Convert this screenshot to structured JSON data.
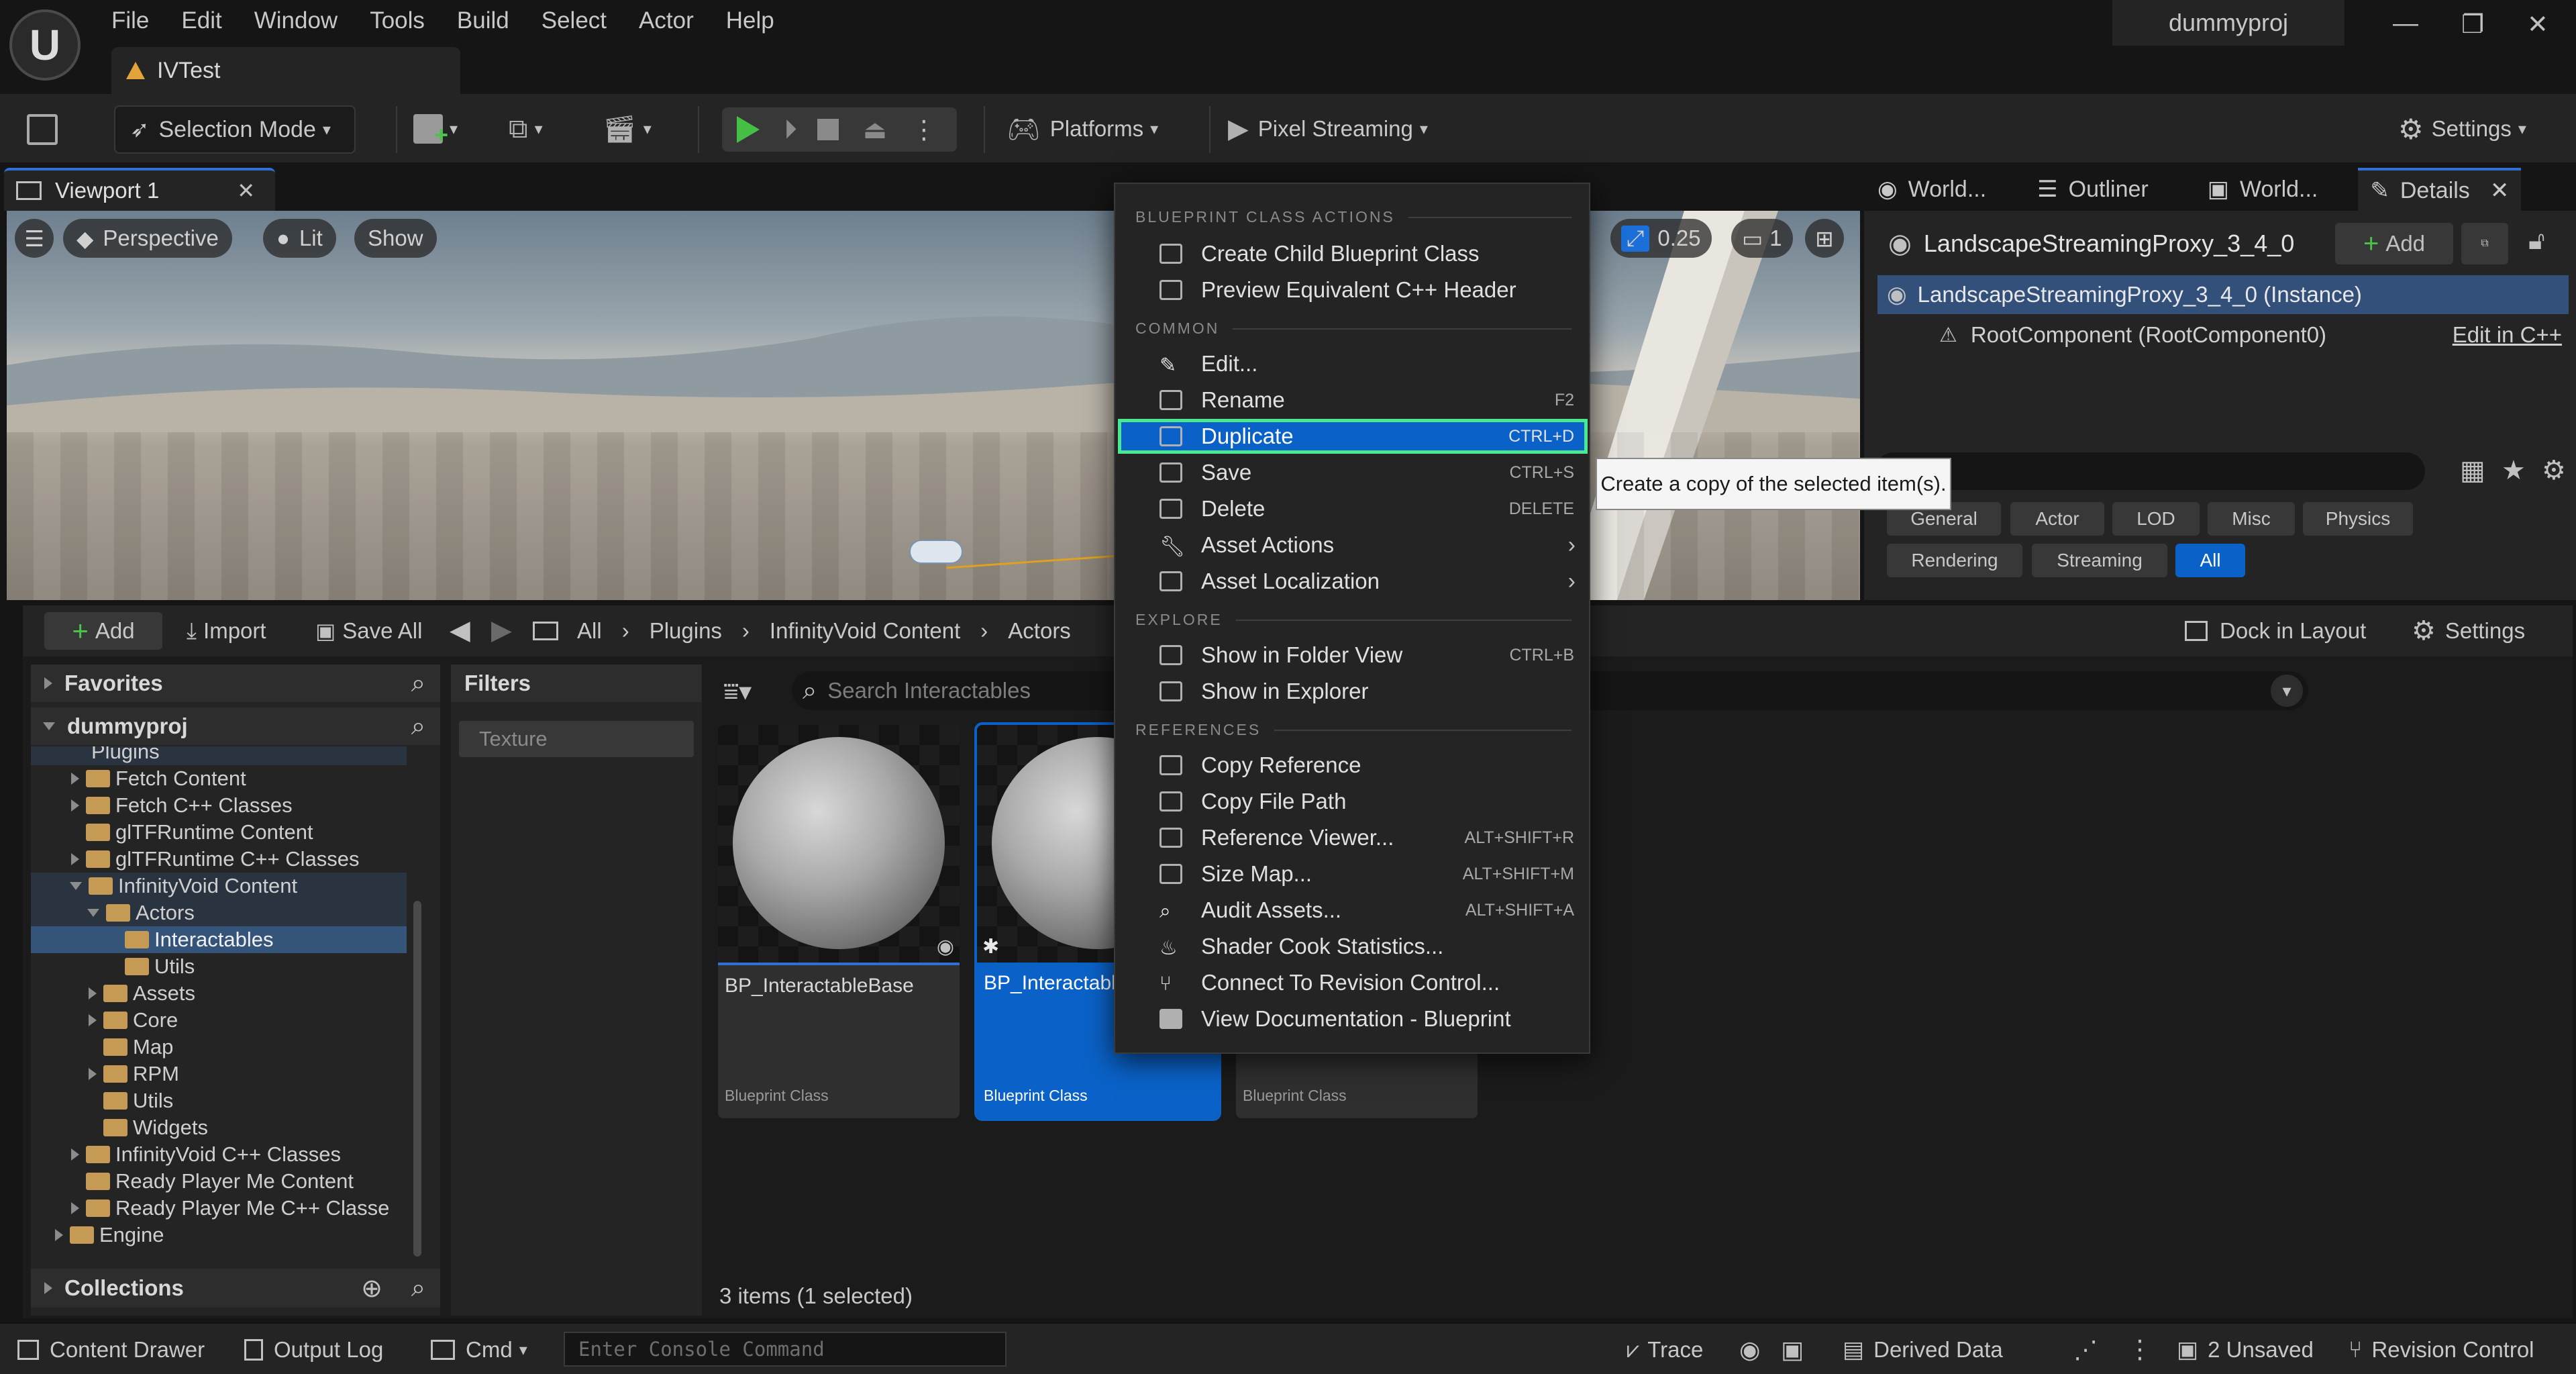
{
  "titlebar": {
    "menu": [
      "File",
      "Edit",
      "Window",
      "Tools",
      "Build",
      "Select",
      "Actor",
      "Help"
    ],
    "project_name": "dummyproj",
    "doc_tab": "IVTest"
  },
  "toolbar": {
    "selection_mode": "Selection Mode",
    "platforms": "Platforms",
    "pixel_streaming": "Pixel Streaming",
    "settings": "Settings"
  },
  "viewport": {
    "tab": "Viewport 1",
    "perspective": "Perspective",
    "lit": "Lit",
    "show": "Show",
    "camera_speed": "0.25",
    "camera_count": "1"
  },
  "details_panel": {
    "tabs": [
      "World...",
      "Outliner",
      "World...",
      "Details"
    ],
    "actor_name": "LandscapeStreamingProxy_3_4_0",
    "add_label": "Add",
    "instance_row": "LandscapeStreamingProxy_3_4_0 (Instance)",
    "root_row": "RootComponent (RootComponent0)",
    "edit_cpp": "Edit in C++",
    "search_placeholder": "rch",
    "filter_chips_row1": [
      "General",
      "Actor",
      "LOD",
      "Misc",
      "Physics"
    ],
    "filter_chips_row2": [
      "Rendering",
      "Streaming",
      "All"
    ]
  },
  "content_browser": {
    "add": "Add",
    "import": "Import",
    "save_all": "Save All",
    "breadcrumbs": [
      "All",
      "Plugins",
      "InfinityVoid Content",
      "Actors"
    ],
    "dock_in_layout": "Dock in Layout",
    "settings": "Settings",
    "favorites": "Favorites",
    "project": "dummyproj",
    "collections": "Collections",
    "filters": "Filters",
    "filter_texture": "Texture",
    "search_placeholder": "Search Interactables",
    "status": "3 items (1 selected)",
    "tree": [
      {
        "label": "Plugins"
      },
      {
        "label": "Fetch Content"
      },
      {
        "label": "Fetch C++ Classes"
      },
      {
        "label": "glTFRuntime Content"
      },
      {
        "label": "glTFRuntime C++ Classes"
      },
      {
        "label": "InfinityVoid Content"
      },
      {
        "label": "Actors"
      },
      {
        "label": "Interactables"
      },
      {
        "label": "Utils"
      },
      {
        "label": "Assets"
      },
      {
        "label": "Core"
      },
      {
        "label": "Map"
      },
      {
        "label": "RPM"
      },
      {
        "label": "Utils"
      },
      {
        "label": "Widgets"
      },
      {
        "label": "InfinityVoid C++ Classes"
      },
      {
        "label": "Ready Player Me Content"
      },
      {
        "label": "Ready Player Me C++ Classe"
      },
      {
        "label": "Engine"
      }
    ],
    "assets": [
      {
        "name": "BP_InteractableBase",
        "type": "Blueprint Class"
      },
      {
        "name": "BP_Interactabl Child",
        "type": "Blueprint Class"
      },
      {
        "name": "",
        "type": "Blueprint Class"
      }
    ]
  },
  "context_menu": {
    "sections": {
      "blueprint": "BLUEPRINT CLASS ACTIONS",
      "common": "COMMON",
      "explore": "EXPLORE",
      "references": "REFERENCES"
    },
    "items": {
      "create_child": "Create Child Blueprint Class",
      "preview_cpp": "Preview Equivalent C++ Header",
      "edit": "Edit...",
      "rename": "Rename",
      "rename_sc": "F2",
      "duplicate": "Duplicate",
      "duplicate_sc": "CTRL+D",
      "save": "Save",
      "save_sc": "CTRL+S",
      "delete": "Delete",
      "delete_sc": "DELETE",
      "asset_actions": "Asset Actions",
      "asset_localization": "Asset Localization",
      "show_folder": "Show in Folder View",
      "show_folder_sc": "CTRL+B",
      "show_explorer": "Show in Explorer",
      "copy_reference": "Copy Reference",
      "copy_file_path": "Copy File Path",
      "reference_viewer": "Reference Viewer...",
      "reference_viewer_sc": "ALT+SHIFT+R",
      "size_map": "Size Map...",
      "size_map_sc": "ALT+SHIFT+M",
      "audit_assets": "Audit Assets...",
      "audit_assets_sc": "ALT+SHIFT+A",
      "shader_cook": "Shader Cook Statistics...",
      "connect_rc": "Connect To Revision Control...",
      "view_docs": "View Documentation - Blueprint"
    },
    "tooltip": "Create a copy of the selected item(s)."
  },
  "statusbar": {
    "content_drawer": "Content Drawer",
    "output_log": "Output Log",
    "cmd": "Cmd",
    "console_placeholder": "Enter Console Command",
    "trace": "Trace",
    "derived_data": "Derived Data",
    "unsaved": "2 Unsaved",
    "revision_control": "Revision Control"
  }
}
